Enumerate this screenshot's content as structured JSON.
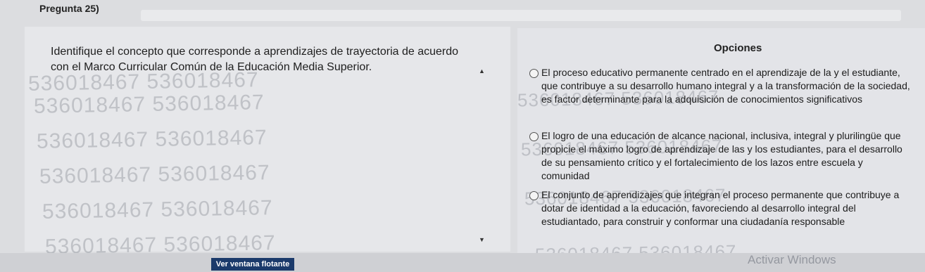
{
  "question": {
    "number_label": "Pregunta 25)",
    "text": "Identifique el concepto que corresponde a aprendizajes de trayectoria de acuerdo con el Marco Curricular Común de la Educación Media Superior."
  },
  "options": {
    "title": "Opciones",
    "items": [
      {
        "label": "El proceso educativo permanente centrado en el aprendizaje de la y el estudiante, que contribuye a su desarrollo humano integral y a la transformación de la sociedad, es factor determinante para la adquisición de conocimientos significativos"
      },
      {
        "label": "El logro de una educación de alcance nacional, inclusiva, integral y plurilingüe que propicie el máximo logro de aprendizaje de las y los estudiantes, para el desarrollo de su pensamiento crítico y el fortalecimiento de los lazos entre escuela y comunidad"
      },
      {
        "label": "El conjunto de aprendizajes que integran el proceso permanente que contribuye a dotar de identidad a la educación, favoreciendo al desarrollo integral del estudiantado, para construir y conformar una ciudadanía responsable"
      }
    ]
  },
  "watermark": {
    "text": "536018467 536018467"
  },
  "floating_button_label": "Ver ventana flotante",
  "activate_windows_text": "Activar Windows"
}
